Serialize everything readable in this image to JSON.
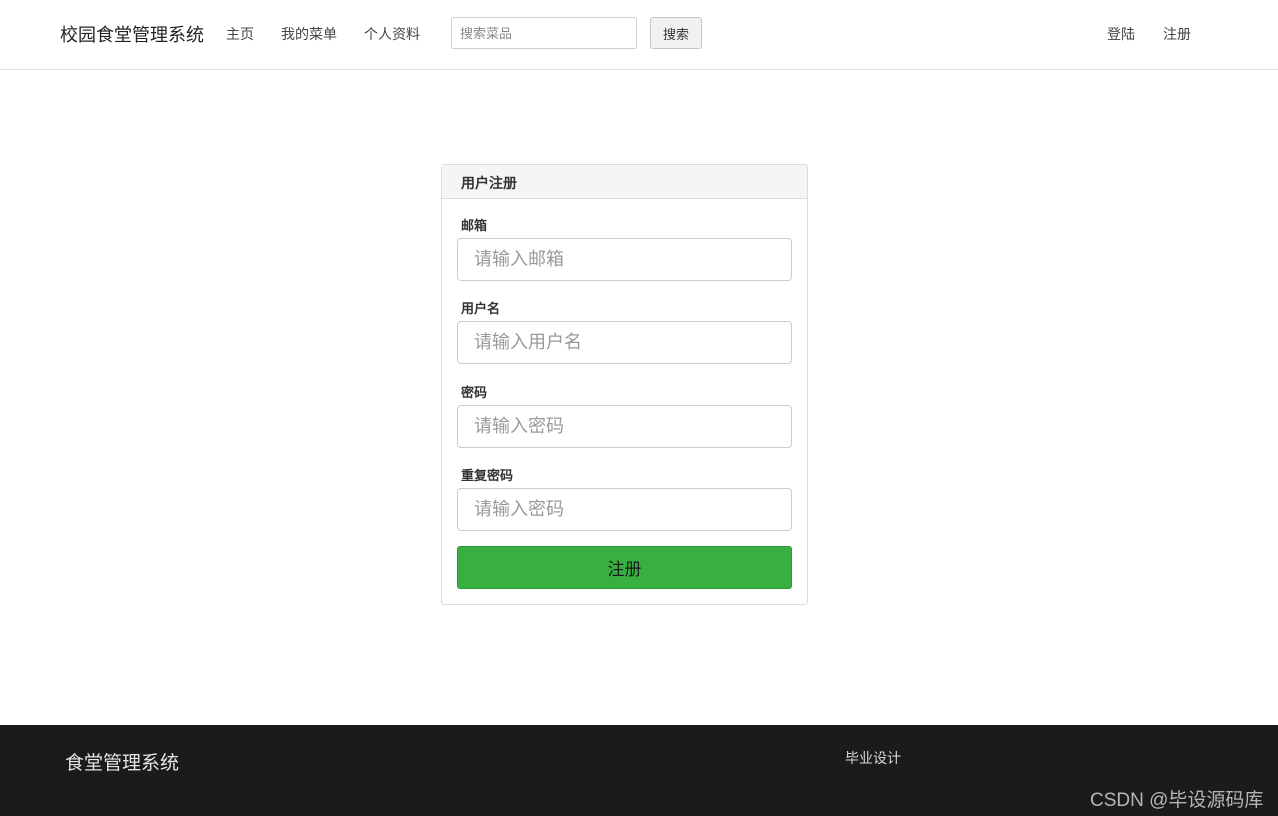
{
  "nav": {
    "brand": "校园食堂管理系统",
    "links": [
      {
        "label": "主页"
      },
      {
        "label": "我的菜单"
      },
      {
        "label": "个人资料"
      }
    ],
    "search": {
      "placeholder": "搜索菜品",
      "value": "",
      "button_label": "搜索"
    },
    "right_links": [
      {
        "label": "登陆"
      },
      {
        "label": "注册"
      }
    ]
  },
  "form": {
    "heading": "用户注册",
    "fields": [
      {
        "label": "邮箱",
        "placeholder": "请输入邮箱",
        "value": ""
      },
      {
        "label": "用户名",
        "placeholder": "请输入用户名",
        "value": ""
      },
      {
        "label": "密码",
        "placeholder": "请输入密码",
        "value": ""
      },
      {
        "label": "重复密码",
        "placeholder": "请输入密码",
        "value": ""
      }
    ],
    "submit_label": "注册",
    "submit_color": "#38b041"
  },
  "footer": {
    "title": "食堂管理系统",
    "link": "毕业设计",
    "watermark": "CSDN @毕设源码库",
    "background": "#1b1b1b"
  }
}
